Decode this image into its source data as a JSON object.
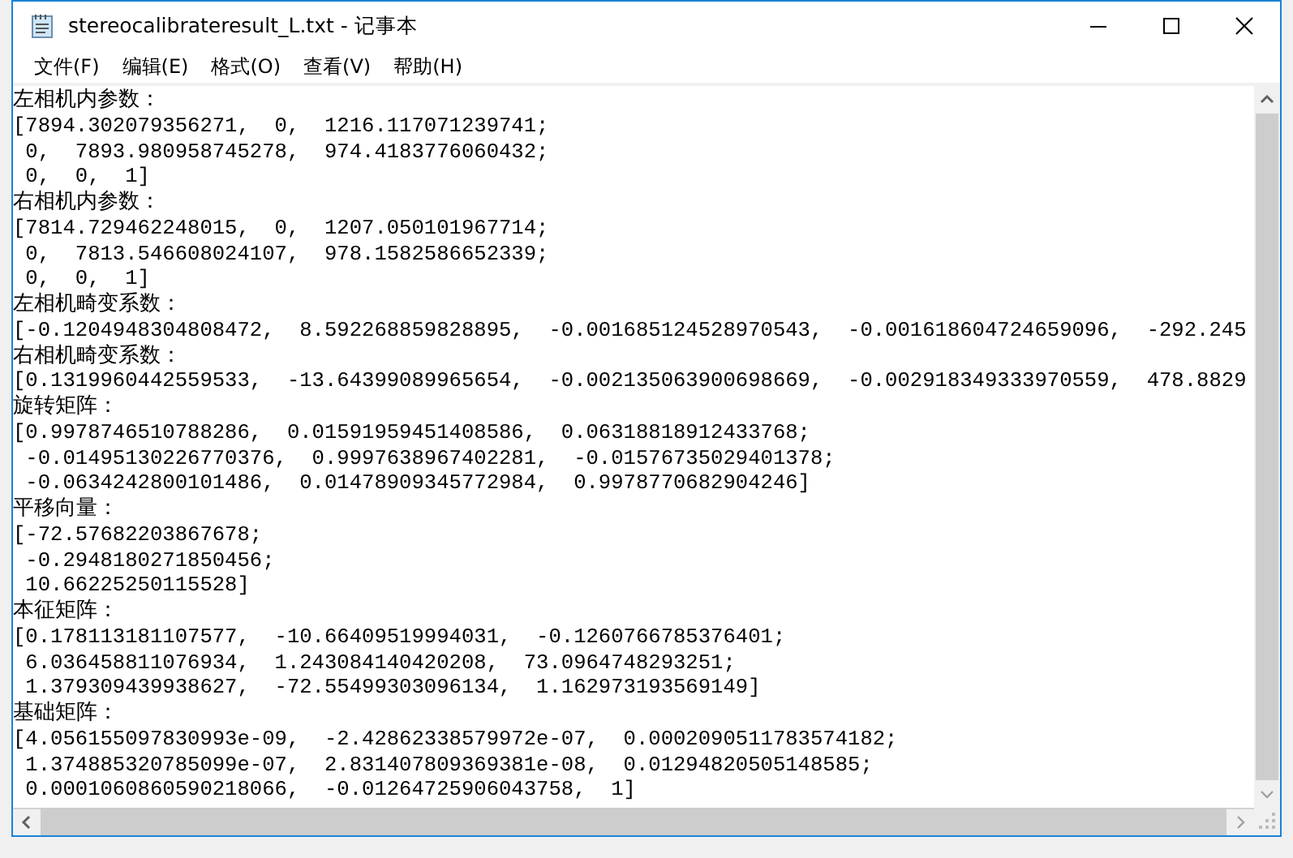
{
  "window": {
    "title": "stereocalibrateresult_L.txt - 记事本"
  },
  "menu": [
    "文件(F)",
    "编辑(E)",
    "格式(O)",
    "查看(V)",
    "帮助(H)"
  ],
  "lines": [
    "左相机内参数：",
    "[7894.302079356271,  0,  1216.117071239741;",
    " 0,  7893.980958745278,  974.4183776060432;",
    " 0,  0,  1]",
    "右相机内参数：",
    "[7814.729462248015,  0,  1207.050101967714;",
    " 0,  7813.546608024107,  978.1582586652339;",
    " 0,  0,  1]",
    "左相机畸变系数：",
    "[-0.1204948304808472,  8.592268859828895,  -0.001685124528970543,  -0.001618604724659096,  -292.245",
    "右相机畸变系数：",
    "[0.1319960442559533,  -13.64399089965654,  -0.002135063900698669,  -0.002918349333970559,  478.8829",
    "旋转矩阵：",
    "[0.9978746510788286,  0.01591959451408586,  0.06318818912433768;",
    " -0.01495130226770376,  0.9997638967402281,  -0.01576735029401378;",
    " -0.0634242800101486,  0.01478909345772984,  0.9978770682904246]",
    "平移向量：",
    "[-72.57682203867678;",
    " -0.2948180271850456;",
    " 10.66225250115528]",
    "本征矩阵：",
    "[0.178113181107577,  -10.66409519994031,  -0.1260766785376401;",
    " 6.036458811076934,  1.243084140420208,  73.0964748293251;",
    " 1.379309439938627,  -72.55499303096134,  1.162973193569149]",
    "基础矩阵：",
    "[4.056155097830993e-09,  -2.42862338579972e-07,  0.0002090511783574182;",
    " 1.374885320785099e-07,  2.831407809369381e-08,  0.01294820505148585;",
    " 0.0001060860590218066,  -0.01264725906043758,  1]"
  ]
}
